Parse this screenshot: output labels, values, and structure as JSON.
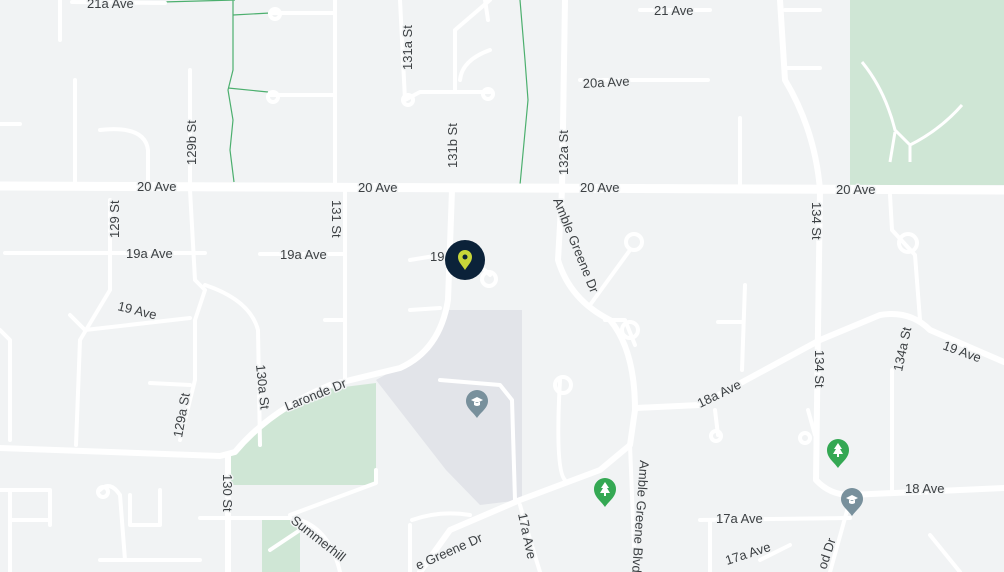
{
  "map": {
    "streets": [
      {
        "id": "20-ave-1",
        "text": "20 Ave"
      },
      {
        "id": "20-ave-2",
        "text": "20 Ave"
      },
      {
        "id": "20-ave-3",
        "text": "20 Ave"
      },
      {
        "id": "20-ave-4",
        "text": "20 Ave"
      },
      {
        "id": "21a-ave",
        "text": "21a Ave"
      },
      {
        "id": "21-ave",
        "text": "21 Ave"
      },
      {
        "id": "20a-ave",
        "text": "20a Ave"
      },
      {
        "id": "131a-st",
        "text": "131a St"
      },
      {
        "id": "129b-st",
        "text": "129b St"
      },
      {
        "id": "131b-st",
        "text": "131b St"
      },
      {
        "id": "132a-st",
        "text": "132a St"
      },
      {
        "id": "129-st",
        "text": "129 St"
      },
      {
        "id": "19a-ave-1",
        "text": "19a Ave"
      },
      {
        "id": "19a-ave-2",
        "text": "19a Ave"
      },
      {
        "id": "19a-ave-3",
        "text": "19"
      },
      {
        "id": "131-st",
        "text": "131 St"
      },
      {
        "id": "amble-greene-dr",
        "text": "Amble Greene Dr"
      },
      {
        "id": "134-st",
        "text": "134 St"
      },
      {
        "id": "19-ave-1",
        "text": "19 Ave"
      },
      {
        "id": "19-ave-2",
        "text": "19 Ave"
      },
      {
        "id": "134a-st",
        "text": "134a St"
      },
      {
        "id": "130a-st",
        "text": "130a St"
      },
      {
        "id": "129a-st",
        "text": "129a St"
      },
      {
        "id": "larode-dr",
        "text": "Laronde Dr"
      },
      {
        "id": "18a-ave",
        "text": "18a Ave"
      },
      {
        "id": "130-st",
        "text": "130 St"
      },
      {
        "id": "amble-greene-blvd",
        "text": "Amble Greene Blvd"
      },
      {
        "id": "18-ave",
        "text": "18 Ave"
      },
      {
        "id": "17a-ave-1",
        "text": "17a Ave"
      },
      {
        "id": "17a-ave-2",
        "text": "17a Ave"
      },
      {
        "id": "17a-ave-3",
        "text": "17a Ave"
      },
      {
        "id": "summerhill",
        "text": "Summerhill"
      },
      {
        "id": "greene-dr",
        "text": "e Greene Dr"
      },
      {
        "id": "d-dr",
        "text": "od Dr"
      }
    ],
    "markers": {
      "location_pin": "location-pin-icon",
      "school_1": "school-icon",
      "school_2": "school-icon",
      "park_1": "tree-icon",
      "park_2": "tree-icon"
    },
    "colors": {
      "background": "#f1f3f4",
      "road": "#ffffff",
      "park": "#cfe6d5",
      "pin_bg": "#0b2239",
      "pin_fg": "#c8d639",
      "school": "#78909c",
      "tree": "#34a853"
    }
  }
}
